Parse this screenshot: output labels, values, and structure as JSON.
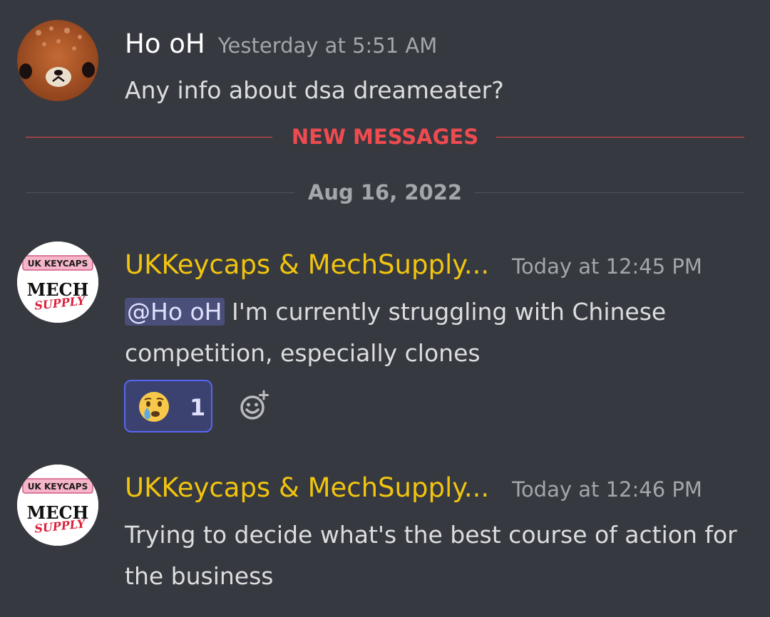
{
  "messages": [
    {
      "author": "Ho oH",
      "timestamp": "Yesterday at 5:51 AM",
      "text": "Any info about dsa dreameater?"
    },
    {
      "author": "UKKeycaps & MechSupply...",
      "timestamp": "Today at 12:45 PM",
      "mention": "@Ho oH",
      "text": " I'm currently struggling with Chinese competition, especially clones",
      "reaction": {
        "emoji": "crying-face-icon",
        "count": "1"
      }
    },
    {
      "author": "UKKeycaps & MechSupply...",
      "timestamp": "Today at 12:46 PM",
      "text": "Trying to decide what's the best course of action for the business"
    }
  ],
  "dividers": {
    "new_messages": "NEW MESSAGES",
    "date": "Aug 16, 2022"
  },
  "avatar_text": {
    "shop_top": "UK KEYCAPS",
    "shop_mid": "MECH",
    "shop_script": "SUPPLY"
  },
  "colors": {
    "background": "#36393f",
    "author_shop": "#f1c40f",
    "new_messages": "#ee4b50",
    "mention_bg": "#4a4f7a",
    "reaction_border": "#5865f2"
  }
}
